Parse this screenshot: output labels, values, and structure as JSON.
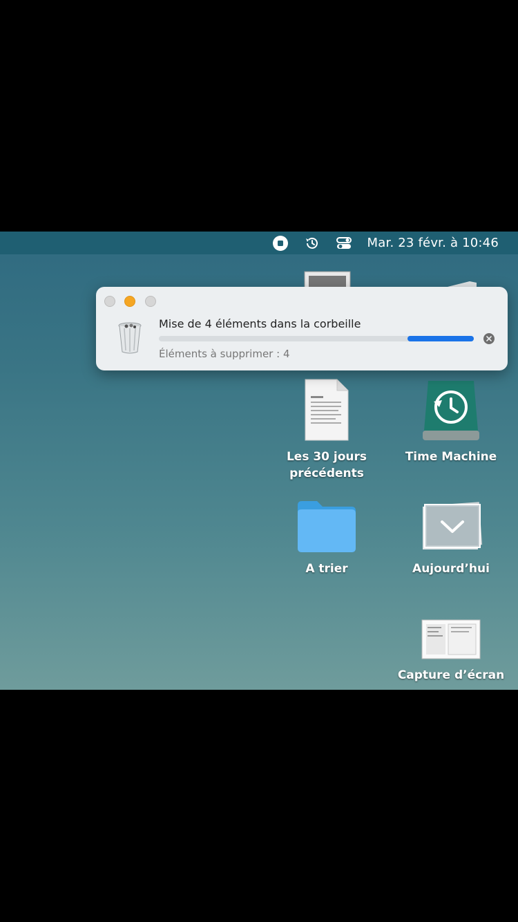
{
  "menubar": {
    "icons": [
      "stop-record-icon",
      "time-machine-icon",
      "control-center-icon"
    ],
    "clock": "Mar. 23 févr. à  10:46"
  },
  "dialog": {
    "title": "Mise de 4 éléments dans la corbeille",
    "status": "Éléments à supprimer : 4",
    "progress_percent": 21,
    "icon": "trash-icon"
  },
  "desktop": {
    "items": [
      {
        "label": "Les 30 jours précédents",
        "icon": "document-icon"
      },
      {
        "label": "Time Machine",
        "icon": "time-machine-drive-icon"
      },
      {
        "label": "A trier",
        "icon": "folder-icon"
      },
      {
        "label": "Aujourd’hui",
        "icon": "stack-icon"
      },
      {
        "label": "Capture d’écran",
        "icon": "screenshot-icon"
      }
    ]
  },
  "colors": {
    "accent": "#1a73e8",
    "menubar": "#1f5f72",
    "close": "#d6d6d6",
    "minimize": "#f5a623",
    "zoom": "#d6d6d6"
  }
}
